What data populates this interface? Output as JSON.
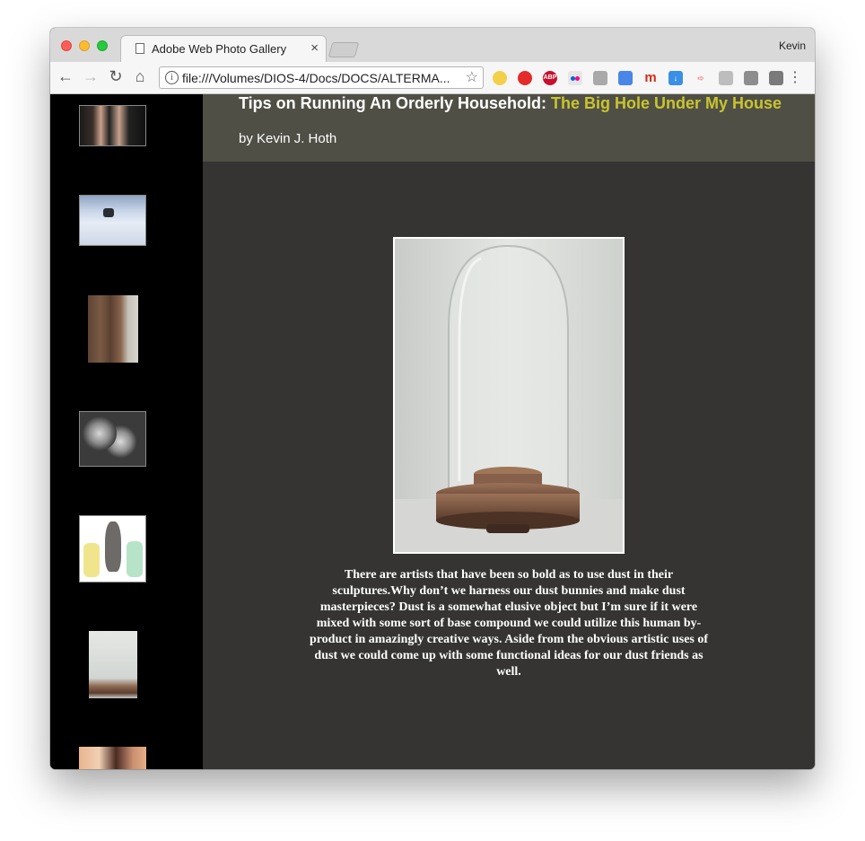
{
  "browser": {
    "tab_title": "Adobe Web Photo Gallery",
    "tab_close": "×",
    "profile_name": "Kevin",
    "url": "file:///Volumes/DIOS-4/Docs/DOCS/ALTERMA...",
    "nav_icons": [
      "back-arrow-icon",
      "forward-arrow-icon",
      "reload-icon",
      "home-icon"
    ],
    "extensions": [
      "emoji-icon",
      "opera-icon",
      "adblock-plus-icon",
      "flickr-icon",
      "drive-icon",
      "translate-icon",
      "m-icon",
      "download-icon",
      "share-icon",
      "r-icon",
      "tools-icon",
      "feather-icon"
    ],
    "adblock_label": "ABP",
    "m_label": "m"
  },
  "page": {
    "title_main": "Tips on Running An Orderly Household:",
    "title_accent": "The Big Hole Under My House",
    "byline": "by Kevin J. Hoth",
    "caption": "There are artists that have been so bold as to use dust in their sculptures.Why don’t we harness our dust bunnies and make dust masterpieces? Dust is a somewhat elusive object but I’m sure if it were mixed with some sort of base compound we could utilize this human by-product in amazingly creative ways. Aside from the obvious artistic uses of dust we could come up with some functional ideas for our dust friends as well.",
    "accent_color": "#c9c52e"
  },
  "thumbnails": [
    "two-people-photo",
    "snow-igloo-photo",
    "books-photo",
    "dust-micrograph-photo",
    "dust-bunny-illustration",
    "glass-dome-photo",
    "partial-photo"
  ]
}
